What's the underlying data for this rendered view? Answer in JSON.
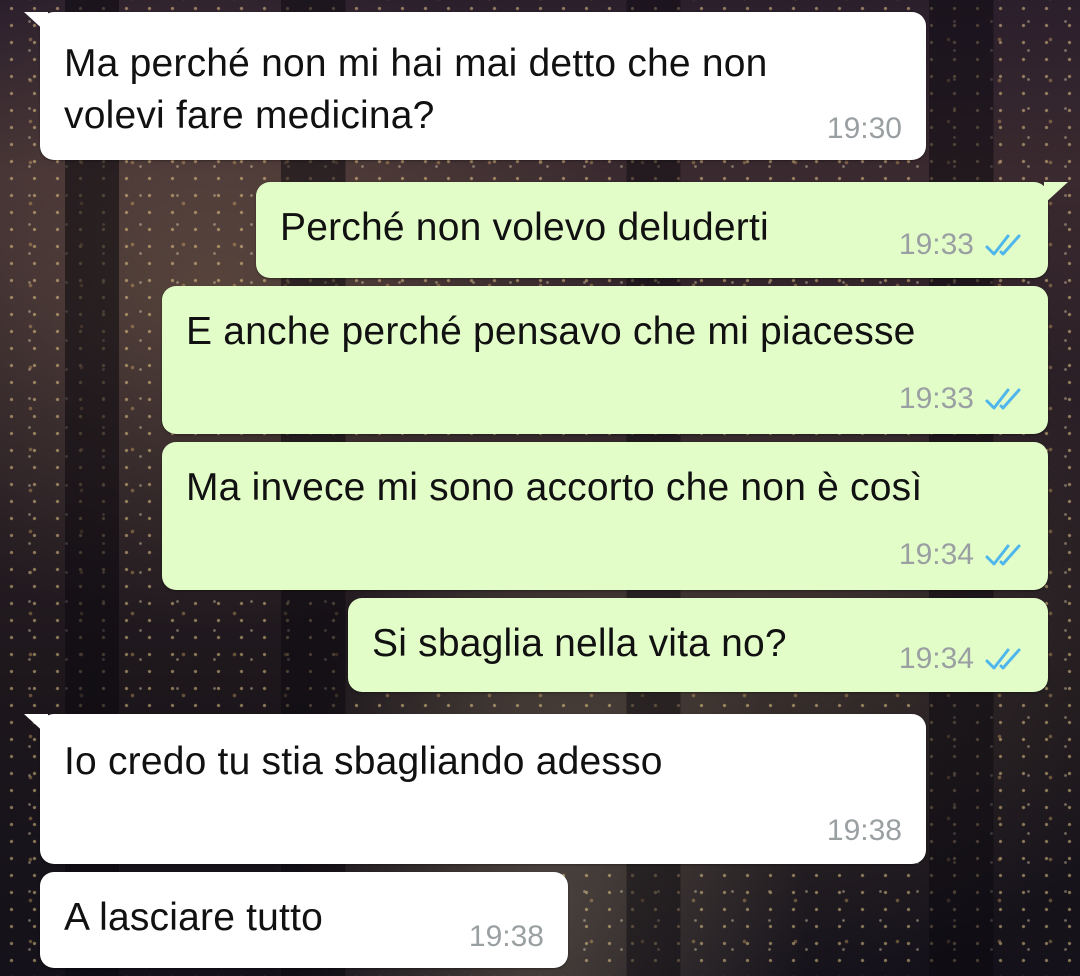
{
  "colors": {
    "incoming_bubble": "#ffffff",
    "outgoing_bubble": "#e3fdc9",
    "timestamp": "#9aa0a2",
    "read_tick": "#4fb6ec"
  },
  "messages": [
    {
      "direction": "in",
      "text": "Ma perché non mi hai mai detto che non",
      "text2": "volevi fare medicina?",
      "time": "19:30"
    },
    {
      "direction": "out",
      "text": "Perché non volevo deluderti",
      "time": "19:33",
      "status": "read",
      "status_icon": "double-check-icon"
    },
    {
      "direction": "out",
      "text": "E anche perché pensavo che mi piacesse",
      "time": "19:33",
      "status": "read",
      "status_icon": "double-check-icon"
    },
    {
      "direction": "out",
      "text": "Ma invece mi sono accorto che non è così",
      "time": "19:34",
      "status": "read",
      "status_icon": "double-check-icon"
    },
    {
      "direction": "out",
      "text": "Si sbaglia nella vita no?",
      "time": "19:34",
      "status": "read",
      "status_icon": "double-check-icon"
    },
    {
      "direction": "in",
      "text": "Io credo tu stia sbagliando adesso",
      "time": "19:38"
    },
    {
      "direction": "in",
      "text": "A lasciare tutto",
      "time": "19:38"
    }
  ]
}
